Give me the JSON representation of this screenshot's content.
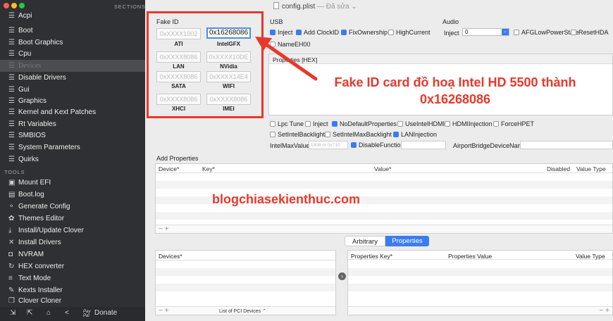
{
  "window": {
    "title": "config.plist",
    "status": "— Đã sửa ⌄"
  },
  "sidebar": {
    "sections_label": "SECTIONS",
    "tools_label": "TOOLS",
    "sections": [
      {
        "label": "Acpi"
      },
      {
        "label": "Boot"
      },
      {
        "label": "Boot Graphics"
      },
      {
        "label": "Cpu"
      },
      {
        "label": "Devices"
      },
      {
        "label": "Disable Drivers"
      },
      {
        "label": "Gui"
      },
      {
        "label": "Graphics"
      },
      {
        "label": "Kernel and Kext Patches"
      },
      {
        "label": "Rt Variables"
      },
      {
        "label": "SMBIOS"
      },
      {
        "label": "System Parameters"
      },
      {
        "label": "Quirks"
      }
    ],
    "tools": [
      {
        "label": "Mount EFI",
        "icon": "disk-icon"
      },
      {
        "label": "Boot.log",
        "icon": "log-icon"
      },
      {
        "label": "Generate Config",
        "icon": "config-icon"
      },
      {
        "label": "Themes Editor",
        "icon": "palette-icon"
      },
      {
        "label": "Install/Update Clover",
        "icon": "download-icon"
      },
      {
        "label": "Install Drivers",
        "icon": "tools-icon"
      },
      {
        "label": "NVRAM",
        "icon": "chip-icon"
      },
      {
        "label": "HEX converter",
        "icon": "refresh-icon"
      },
      {
        "label": "Text Mode",
        "icon": "text-icon"
      },
      {
        "label": "Kexts Installer",
        "icon": "wrench-icon"
      },
      {
        "label": "Clover Cloner",
        "icon": "clone-icon"
      }
    ],
    "donate_label": "Donate",
    "pay_label": "Pay Pal"
  },
  "fake_id": {
    "title": "Fake ID",
    "items": [
      {
        "value": "0xXXXX1002",
        "label": "ATI"
      },
      {
        "value": "0x16268086",
        "label": "IntelGFX"
      },
      {
        "value": "0xXXXX8086",
        "label": "LAN"
      },
      {
        "value": "0xXXXX10DE",
        "label": "NVidia"
      },
      {
        "value": "0xXXXX8086",
        "label": "SATA"
      },
      {
        "value": "0xXXXX14E4",
        "label": "WIFI"
      },
      {
        "value": "0xXXXX8086",
        "label": "XHCI"
      },
      {
        "value": "0xXXXX8086",
        "label": "IMEI"
      }
    ]
  },
  "usb": {
    "title": "USB",
    "inject": "Inject",
    "add_clockid": "Add ClockID",
    "fix_ownership": "FixOwnership",
    "high_current": "HighCurrent",
    "name_eh00": "NameEH00"
  },
  "audio": {
    "title": "Audio",
    "inject_label": "Inject",
    "inject_value": "0",
    "afg": "AFGLowPowerState",
    "reset_hda": "ResetHDA"
  },
  "properties_hex": {
    "title": "Properties [HEX]"
  },
  "flags": {
    "lpc_tune": "Lpc Tune",
    "inject": "Inject",
    "no_default": "NoDefaultProperties",
    "use_intel_hdmi": "UseIntelHDMI",
    "hdmi_injection": "HDMIInjection",
    "force_hpet": "ForceHPET",
    "set_intel_backlight": "SetIntelBacklight",
    "set_intel_max_backlight": "SetIntelMaxBacklight",
    "lan_injection": "LANInjection",
    "intel_max_value": "IntelMaxValue",
    "intel_max_placeholder": "1808 or 0x710",
    "disable_functions": "DisableFunctions",
    "airport": "AirportBridgeDeviceName"
  },
  "add_properties": {
    "title": "Add Properties",
    "columns": [
      "Device*",
      "Key*",
      "Value*",
      "Disabled",
      "Value Type"
    ]
  },
  "bottom": {
    "tab_arbitrary": "Arbitrary",
    "tab_properties": "Properties",
    "devices_col": "Devices*",
    "props_key_col": "Properties Key*",
    "props_value_col": "Properties Value",
    "value_type_col": "Value Type",
    "pci_list": "List of PCI Devices ⌃"
  },
  "annotations": {
    "fake_id_caption": "Fake ID card đồ hoạ Intel HD 5500 thành",
    "fake_id_value": "0x16268086",
    "watermark": "blogchiasekienthuc.com"
  },
  "colors": {
    "accent": "#3b7ded",
    "annotation_red": "#e8382b",
    "sidebar_bg": "#2f3033"
  }
}
